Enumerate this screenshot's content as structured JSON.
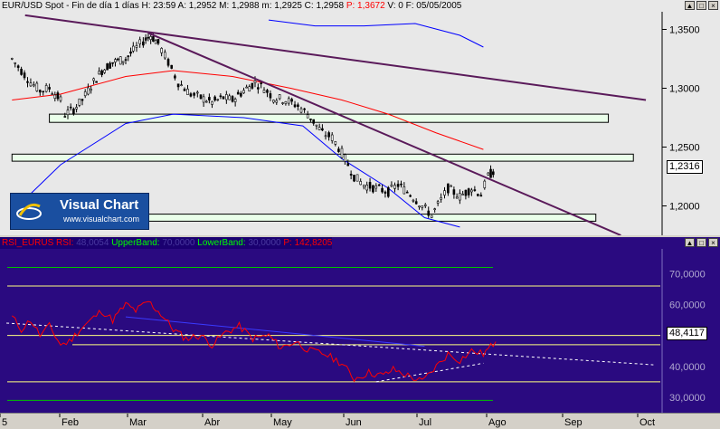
{
  "price_panel": {
    "title_segments": [
      {
        "text": "EUR/USD Spot - Fin de día 1 días",
        "color": "#000000"
      },
      {
        "text": "H: 23:59",
        "color": "#000000"
      },
      {
        "text": "A: 1,2952",
        "color": "#000000"
      },
      {
        "text": "M: 1,2988",
        "color": "#000000"
      },
      {
        "text": "m: 1,2925",
        "color": "#000000"
      },
      {
        "text": "C: 1,2958",
        "color": "#000000"
      },
      {
        "text": "P: 1,3672",
        "color": "#ff0000"
      },
      {
        "text": "V: 0",
        "color": "#000000"
      },
      {
        "text": "F: 05/05/2005",
        "color": "#000000"
      }
    ],
    "y_ticks": [
      "1,3500",
      "1,3000",
      "1,2500",
      "1,2000"
    ],
    "current_value": "1,2316",
    "buttons": [
      "▲",
      "□",
      "×"
    ]
  },
  "logo": {
    "title": "Visual Chart",
    "url": "www.visualchart.com"
  },
  "rsi_panel": {
    "title_segments": [
      {
        "text": "RSI_EURUS",
        "color": "#ff0000"
      },
      {
        "text": "RSI:",
        "color": "#ff0000"
      },
      {
        "text": "48,0054",
        "color": "#4a3aa0"
      },
      {
        "text": "UpperBand:",
        "color": "#00ff00"
      },
      {
        "text": "70,0000",
        "color": "#4a3aa0"
      },
      {
        "text": "LowerBand:",
        "color": "#00ff00"
      },
      {
        "text": "30,0000",
        "color": "#4a3aa0"
      },
      {
        "text": "P: 142,8205",
        "color": "#ff0000"
      }
    ],
    "y_ticks": [
      "70,0000",
      "60,0000",
      "50,0000",
      "40,0000",
      "30,0000"
    ],
    "current_value": "48,4117",
    "buttons": [
      "▲",
      "□",
      "×"
    ]
  },
  "time_axis": {
    "labels": [
      "5",
      "Feb",
      "Mar",
      "Abr",
      "May",
      "Jun",
      "Jul",
      "Ago",
      "Sep",
      "Oct"
    ]
  },
  "colors": {
    "price_bg": "#e8e8e8",
    "rsi_bg": "#2a0a80",
    "candle": "#000000",
    "ma_red": "#ff0000",
    "band_blue": "#0000ff",
    "trendline": "#5a1a5a",
    "zone_fill": "#eaffea",
    "rsi_line": "#ff0000",
    "rsi_green": "#00c000",
    "rsi_yellow": "#ffff80"
  },
  "chart_data": [
    {
      "type": "candlestick",
      "title": "EUR/USD Spot - Fin de día 1 días",
      "ylim": [
        1.175,
        1.365
      ],
      "y_ticks": [
        1.35,
        1.3,
        1.25,
        1.2
      ],
      "x_ticks": [
        "5",
        "Feb",
        "Mar",
        "Abr",
        "May",
        "Jun",
        "Jul",
        "Ago",
        "Sep",
        "Oct"
      ],
      "last_value": 1.2316,
      "close_path": [
        [
          "Jan-05",
          1.325
        ],
        [
          "Jan-10",
          1.315
        ],
        [
          "Jan-15",
          1.305
        ],
        [
          "Jan-20",
          1.298
        ],
        [
          "Jan-25",
          1.3
        ],
        [
          "Jan-31",
          1.29
        ],
        [
          "Feb-03",
          1.278
        ],
        [
          "Feb-07",
          1.282
        ],
        [
          "Feb-11",
          1.29
        ],
        [
          "Feb-15",
          1.302
        ],
        [
          "Feb-20",
          1.315
        ],
        [
          "Feb-25",
          1.322
        ],
        [
          "Mar-01",
          1.325
        ],
        [
          "Mar-04",
          1.332
        ],
        [
          "Mar-08",
          1.34
        ],
        [
          "Mar-11",
          1.345
        ],
        [
          "Mar-14",
          1.338
        ],
        [
          "Mar-18",
          1.322
        ],
        [
          "Mar-22",
          1.305
        ],
        [
          "Mar-27",
          1.295
        ],
        [
          "Apr-01",
          1.292
        ],
        [
          "Apr-06",
          1.288
        ],
        [
          "Apr-11",
          1.292
        ],
        [
          "Apr-15",
          1.29
        ],
        [
          "Apr-20",
          1.298
        ],
        [
          "Apr-25",
          1.305
        ],
        [
          "Apr-29",
          1.3
        ],
        [
          "May-03",
          1.292
        ],
        [
          "May-08",
          1.29
        ],
        [
          "May-13",
          1.285
        ],
        [
          "May-17",
          1.278
        ],
        [
          "May-23",
          1.262
        ],
        [
          "May-27",
          1.258
        ],
        [
          "Jun-01",
          1.245
        ],
        [
          "Jun-06",
          1.225
        ],
        [
          "Jun-10",
          1.218
        ],
        [
          "Jun-15",
          1.215
        ],
        [
          "Jun-20",
          1.212
        ],
        [
          "Jun-24",
          1.218
        ],
        [
          "Jun-29",
          1.21
        ],
        [
          "Jul-04",
          1.2
        ],
        [
          "Jul-08",
          1.192
        ],
        [
          "Jul-12",
          1.205
        ],
        [
          "Jul-15",
          1.215
        ],
        [
          "Jul-20",
          1.208
        ],
        [
          "Jul-25",
          1.215
        ],
        [
          "Jul-29",
          1.21
        ],
        [
          "Aug-02",
          1.225
        ],
        [
          "Aug-05",
          1.232
        ]
      ],
      "moving_average_red": [
        [
          "Jan-05",
          1.29
        ],
        [
          "Feb-01",
          1.295
        ],
        [
          "Mar-01",
          1.31
        ],
        [
          "Mar-20",
          1.315
        ],
        [
          "Apr-15",
          1.31
        ],
        [
          "May-10",
          1.3
        ],
        [
          "Jun-01",
          1.29
        ],
        [
          "Jun-20",
          1.278
        ],
        [
          "Jul-10",
          1.262
        ],
        [
          "Jul-30",
          1.248
        ]
      ],
      "upper_band_blue": [
        [
          "May-01",
          1.358
        ],
        [
          "May-20",
          1.353
        ],
        [
          "Jun-10",
          1.353
        ],
        [
          "Jul-01",
          1.355
        ],
        [
          "Jul-20",
          1.345
        ],
        [
          "Jul-30",
          1.335
        ]
      ],
      "lower_band_blue": [
        [
          "Jan-05",
          1.195
        ],
        [
          "Jan-31",
          1.235
        ],
        [
          "Mar-01",
          1.27
        ],
        [
          "Mar-20",
          1.278
        ],
        [
          "Apr-20",
          1.275
        ],
        [
          "May-15",
          1.268
        ],
        [
          "Jun-01",
          1.24
        ],
        [
          "Jun-20",
          1.215
        ],
        [
          "Jul-05",
          1.19
        ],
        [
          "Jul-20",
          1.182
        ]
      ],
      "trendlines": [
        {
          "from": [
            "Jan-12",
            1.362
          ],
          "to": [
            "Oct-05",
            1.29
          ]
        },
        {
          "from": [
            "Mar-10",
            1.347
          ],
          "to": [
            "Sep-25",
            1.175
          ]
        }
      ],
      "zones": [
        {
          "from": "Jan-25",
          "to": "Sep-20",
          "y_high": 1.278,
          "y_low": 1.271
        },
        {
          "from": "Jan-05",
          "to": "Sep-30",
          "y_high": 1.244,
          "y_low": 1.238
        },
        {
          "from": "Jan-05",
          "to": "Sep-15",
          "y_high": 1.193,
          "y_low": 1.187
        }
      ]
    },
    {
      "type": "line",
      "title": "RSI_EURUS",
      "ylim": [
        25,
        78
      ],
      "y_ticks": [
        70,
        60,
        50,
        40,
        30
      ],
      "bands": {
        "upper": 70,
        "lower": 30
      },
      "last_value": 48.4117,
      "rsi_values": [
        [
          "Jan-05",
          56
        ],
        [
          "Jan-10",
          52
        ],
        [
          "Jan-15",
          55
        ],
        [
          "Jan-20",
          50
        ],
        [
          "Jan-25",
          53
        ],
        [
          "Jan-31",
          47
        ],
        [
          "Feb-05",
          48
        ],
        [
          "Feb-10",
          52
        ],
        [
          "Feb-15",
          55
        ],
        [
          "Feb-20",
          58
        ],
        [
          "Feb-25",
          55
        ],
        [
          "Mar-01",
          60
        ],
        [
          "Mar-05",
          58
        ],
        [
          "Mar-10",
          61
        ],
        [
          "Mar-15",
          57
        ],
        [
          "Mar-20",
          52
        ],
        [
          "Mar-25",
          49
        ],
        [
          "Apr-01",
          50
        ],
        [
          "Apr-06",
          47
        ],
        [
          "Apr-12",
          51
        ],
        [
          "Apr-18",
          53
        ],
        [
          "Apr-24",
          49
        ],
        [
          "May-01",
          50
        ],
        [
          "May-06",
          46
        ],
        [
          "May-12",
          48
        ],
        [
          "May-18",
          45
        ],
        [
          "May-24",
          44
        ],
        [
          "Jun-01",
          41
        ],
        [
          "Jun-06",
          36
        ],
        [
          "Jun-12",
          38
        ],
        [
          "Jun-18",
          37
        ],
        [
          "Jun-22",
          39
        ],
        [
          "Jun-28",
          37
        ],
        [
          "Jul-04",
          35
        ],
        [
          "Jul-10",
          40
        ],
        [
          "Jul-15",
          44
        ],
        [
          "Jul-20",
          42
        ],
        [
          "Jul-25",
          45
        ],
        [
          "Jul-30",
          44
        ],
        [
          "Aug-05",
          48
        ]
      ],
      "lines": [
        {
          "from": [
            "Jan-02",
            54
          ],
          "to": [
            "Oct-08",
            40.5
          ],
          "style": "dashed"
        },
        {
          "from": [
            "Mar-01",
            56
          ],
          "to": [
            "Jul-05",
            46.5
          ],
          "style": "solid-blue"
        },
        {
          "from": [
            "Jun-15",
            35
          ],
          "to": [
            "Jul-30",
            41
          ],
          "style": "dashed"
        }
      ]
    }
  ]
}
